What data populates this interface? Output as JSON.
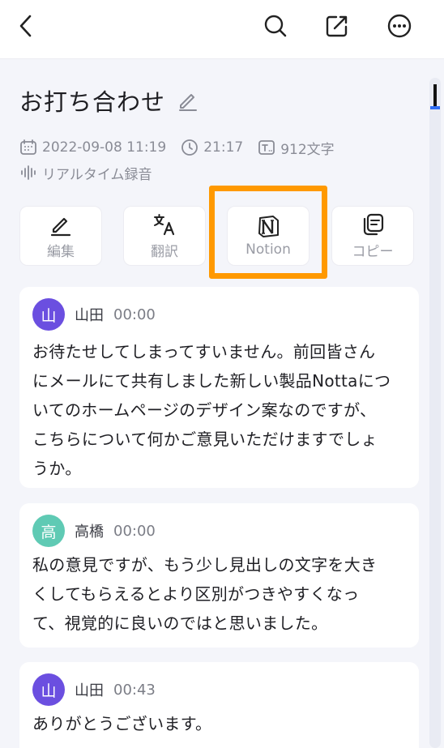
{
  "header": {
    "back_icon": "chevron-left-icon",
    "search_icon": "search-icon",
    "share_icon": "share-icon",
    "more_icon": "more-icon"
  },
  "note": {
    "title": "お打ち合わせ",
    "date": "2022-09-08 11:19",
    "duration": "21:17",
    "char_count": "912文字",
    "source": "リアルタイム録音"
  },
  "actions": [
    {
      "label": "編集",
      "icon": "pencil-icon"
    },
    {
      "label": "翻訳",
      "icon": "translate-icon"
    },
    {
      "label": "Notion",
      "icon": "notion-icon"
    },
    {
      "label": "コピー",
      "icon": "copy-icon"
    }
  ],
  "transcript": [
    {
      "avatar": "山",
      "speaker": "山田",
      "time": "00:00",
      "color": "#6b4fe0",
      "lines": [
        "お待たせしてしまってすいません。前回皆さん",
        "にメールにて共有しました新しい製品Nottaにつ",
        "いてのホームページのデザイン案なのですが、",
        "こちらについて何かご意見いただけますでしょ",
        "うか。"
      ]
    },
    {
      "avatar": "高",
      "speaker": "高橋",
      "time": "00:00",
      "color": "#5fcab4",
      "lines": [
        "私の意見ですが、もう少し見出しの文字を大き",
        "くしてもらえるとより区別がつきやすくなっ",
        "て、視覚的に良いのではと思いました。"
      ]
    },
    {
      "avatar": "山",
      "speaker": "山田",
      "time": "00:43",
      "color": "#6b4fe0",
      "lines": [
        "ありがとうございます。"
      ]
    }
  ],
  "colors": {
    "highlight": "#ff9900",
    "accent": "#2f6df6"
  }
}
